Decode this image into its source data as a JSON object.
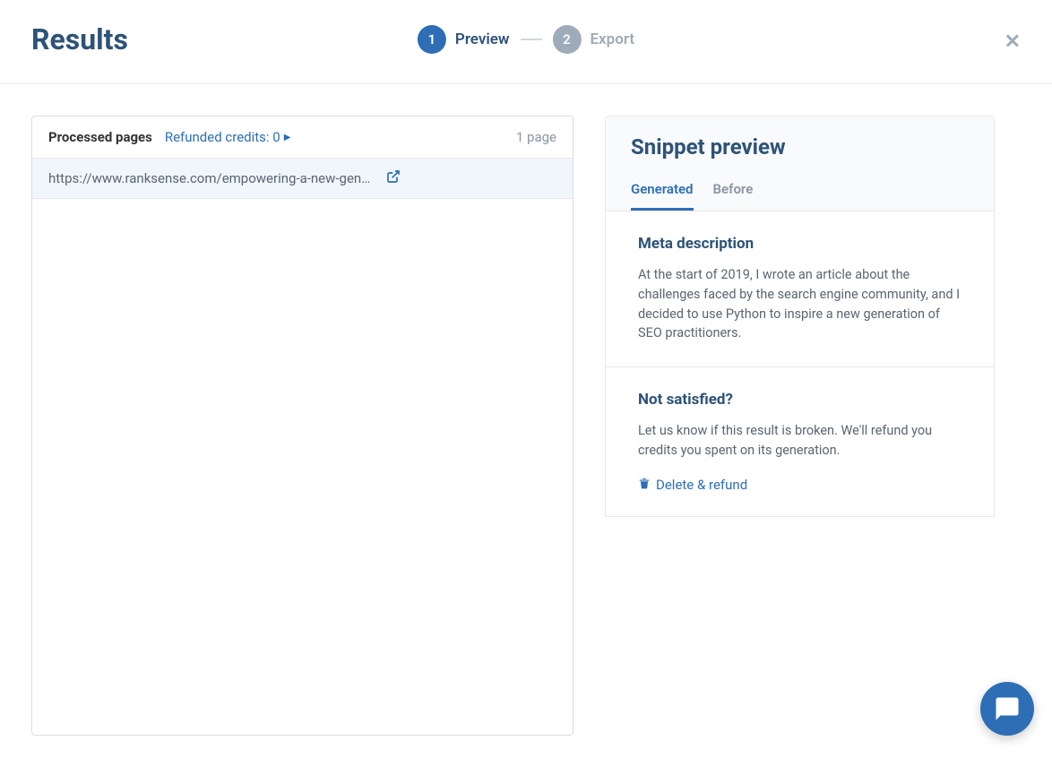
{
  "header": {
    "title": "Results",
    "steps": [
      {
        "number": "1",
        "label": "Preview",
        "active": true
      },
      {
        "number": "2",
        "label": "Export",
        "active": false
      }
    ]
  },
  "leftPanel": {
    "processedLabel": "Processed pages",
    "refundedLabel": "Refunded credits: 0",
    "pageCount": "1 page",
    "urls": [
      {
        "text": "https://www.ranksense.com/empowering-a-new-gen…"
      }
    ]
  },
  "rightPanel": {
    "title": "Snippet preview",
    "tabs": [
      {
        "label": "Generated",
        "active": true
      },
      {
        "label": "Before",
        "active": false
      }
    ],
    "meta": {
      "title": "Meta description",
      "text": "At the start of 2019, I wrote an article about the challenges faced by the search engine community, and I decided to use Python to inspire a new generation of SEO practitioners."
    },
    "notSatisfied": {
      "title": "Not satisfied?",
      "text": "Let us know if this result is broken. We'll refund you credits you spent on its generation.",
      "action": "Delete & refund"
    }
  }
}
